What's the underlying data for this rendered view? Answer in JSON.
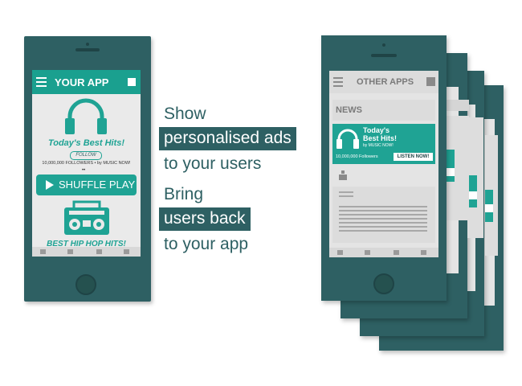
{
  "colors": {
    "teal": "#1fa394",
    "phone": "#2e6063",
    "screen": "#eaeaea"
  },
  "left_phone": {
    "app_title": "YOUR APP",
    "menu_icon": "hamburger-icon",
    "promo_title": "Today's Best Hits!",
    "follow_label": "FOLLOW",
    "followers_line": "10,000,000 FOLLOWERS • by MUSIC NOW!",
    "shuffle_label": "SHUFFLE PLAY",
    "bottom_title": "BEST HIP HOP HITS!"
  },
  "right_phone": {
    "app_title": "OTHER APPS",
    "news_label": "NEWS",
    "ad_title_line1": "Today's",
    "ad_title_line2": "Best Hits!",
    "ad_by": "by MUSIC NOW!",
    "ad_followers": "10,000,000 Followers",
    "listen_label": "LISTEN NOW!"
  },
  "messages": {
    "line1": "Show",
    "line2": "personalised ads",
    "line3": "to your users",
    "line4": "Bring",
    "line5": "users back",
    "line6": "to your app"
  }
}
